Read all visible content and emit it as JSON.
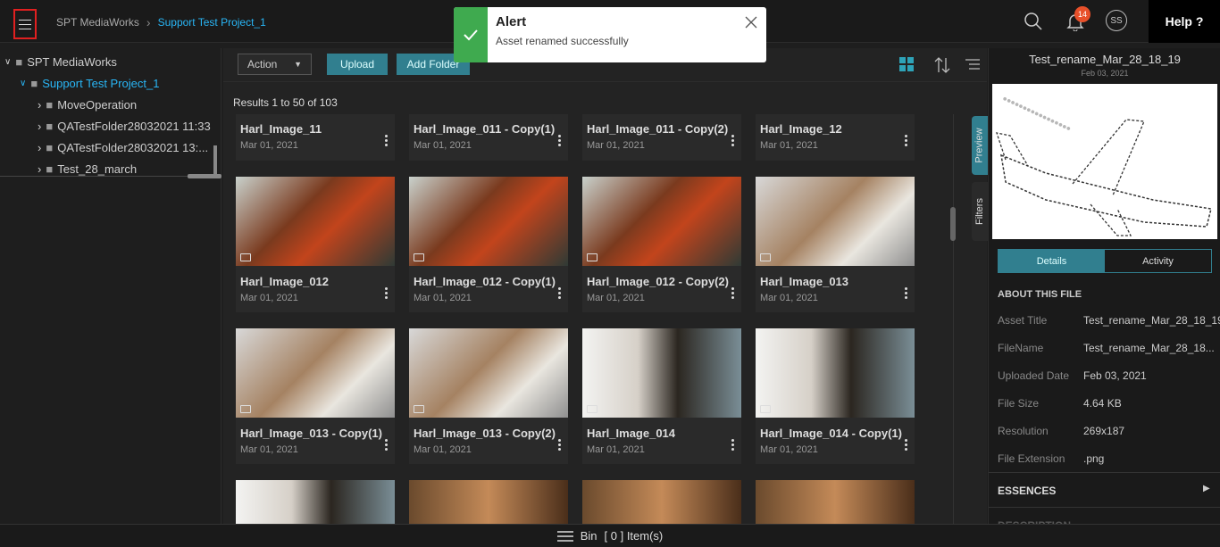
{
  "header": {
    "root_crumb": "SPT MediaWorks",
    "current_crumb": "Support Test Project_1",
    "notif_count": "14",
    "avatar": "SS",
    "help": "Help ?"
  },
  "alert": {
    "title": "Alert",
    "message": "Asset renamed successfully"
  },
  "tree": {
    "items": [
      {
        "label": "SPT MediaWorks"
      },
      {
        "label": "Support Test Project_1"
      },
      {
        "label": "MoveOperation"
      },
      {
        "label": "QATestFolder28032021 11:33"
      },
      {
        "label": "QATestFolder28032021 13:..."
      },
      {
        "label": "Test_28_march"
      }
    ]
  },
  "toolbar": {
    "action": "Action",
    "upload": "Upload",
    "add_folder": "Add Folder"
  },
  "results": "Results 1 to 50 of 103",
  "cards": [
    {
      "name": "Harl_Image_11",
      "date": "Mar 01, 2021"
    },
    {
      "name": "Harl_Image_011 - Copy(1)",
      "date": "Mar 01, 2021"
    },
    {
      "name": "Harl_Image_011 - Copy(2)",
      "date": "Mar 01, 2021"
    },
    {
      "name": "Harl_Image_12",
      "date": "Mar 01, 2021"
    },
    {
      "name": "Harl_Image_012",
      "date": "Mar 01, 2021"
    },
    {
      "name": "Harl_Image_012 - Copy(1)",
      "date": "Mar 01, 2021"
    },
    {
      "name": "Harl_Image_012 - Copy(2)",
      "date": "Mar 01, 2021"
    },
    {
      "name": "Harl_Image_013",
      "date": "Mar 01, 2021"
    },
    {
      "name": "Harl_Image_013 - Copy(1)",
      "date": "Mar 01, 2021"
    },
    {
      "name": "Harl_Image_013 - Copy(2)",
      "date": "Mar 01, 2021"
    },
    {
      "name": "Harl_Image_014",
      "date": "Mar 01, 2021"
    },
    {
      "name": "Harl_Image_014 - Copy(1)",
      "date": "Mar 01, 2021"
    }
  ],
  "side_tabs": {
    "preview": "Preview",
    "filters": "Filters"
  },
  "details": {
    "title": "Test_rename_Mar_28_18_19",
    "date": "Feb 03, 2021",
    "tab_details": "Details",
    "tab_activity": "Activity",
    "about": "ABOUT THIS FILE",
    "fields": [
      {
        "k": "Asset Title",
        "v": "Test_rename_Mar_28_18_19"
      },
      {
        "k": "FileName",
        "v": "Test_rename_Mar_28_18..."
      },
      {
        "k": "Uploaded Date",
        "v": "Feb 03, 2021"
      },
      {
        "k": "File Size",
        "v": "4.64 KB"
      },
      {
        "k": "Resolution",
        "v": "269x187"
      },
      {
        "k": "File Extension",
        "v": ".png"
      }
    ],
    "essences": "ESSENCES",
    "description": "DESCRIPTION"
  },
  "bin": {
    "label": "Bin",
    "count": "[ 0 ] Item(s)"
  }
}
